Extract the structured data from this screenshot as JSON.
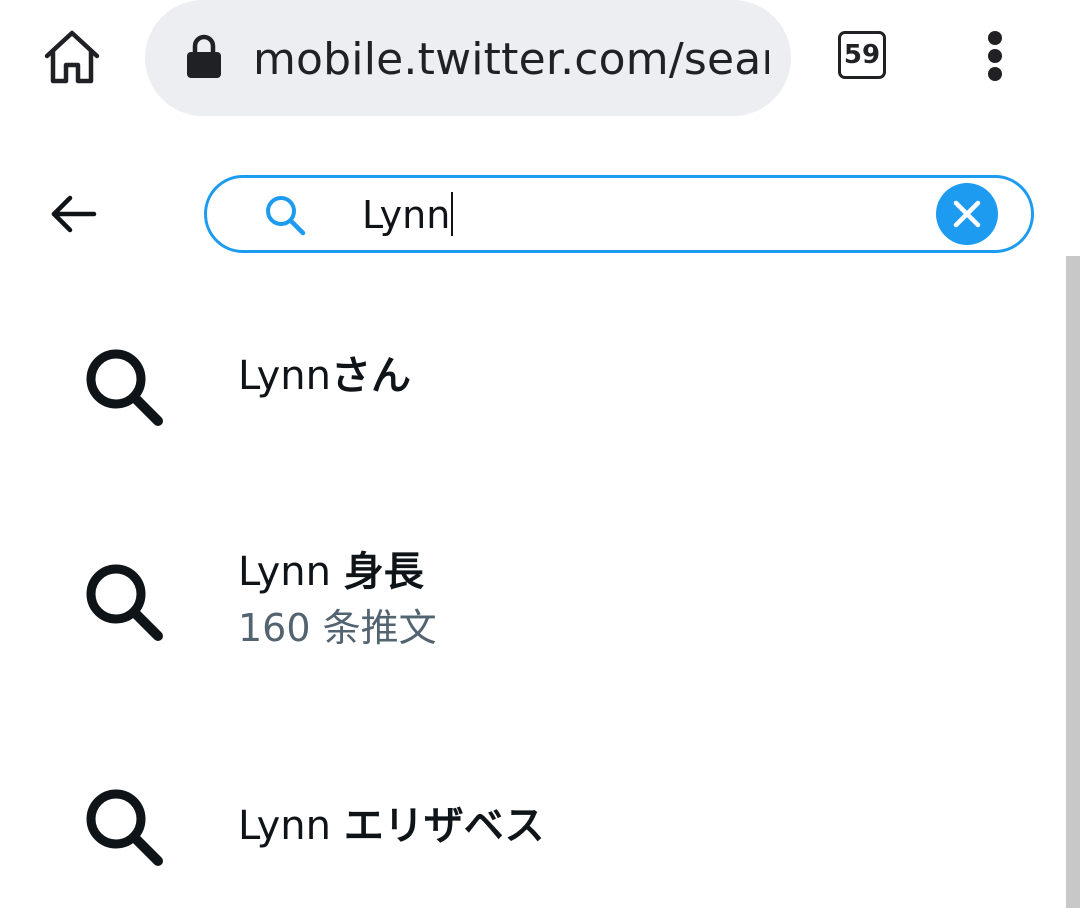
{
  "browser": {
    "url": "mobile.twitter.com/search",
    "tab_count": "59",
    "icons": {
      "home": "home-icon",
      "lock": "lock-icon",
      "menu": "more-vertical-icon"
    }
  },
  "search": {
    "query": "Lynn",
    "icons": {
      "back": "arrow-left-icon",
      "search": "search-icon",
      "clear": "clear-icon"
    },
    "accent_color": "#1d9bf0"
  },
  "suggestions": [
    {
      "query": "Lynn",
      "suffix": "さん",
      "subtext": ""
    },
    {
      "query": "Lynn ",
      "suffix": "身長",
      "subtext": "160 条推文"
    },
    {
      "query": "Lynn ",
      "suffix": "エリザベス",
      "subtext": ""
    }
  ],
  "colors": {
    "text_primary": "#0f1419",
    "text_secondary": "#536471",
    "url_pill": "#eceef1"
  }
}
